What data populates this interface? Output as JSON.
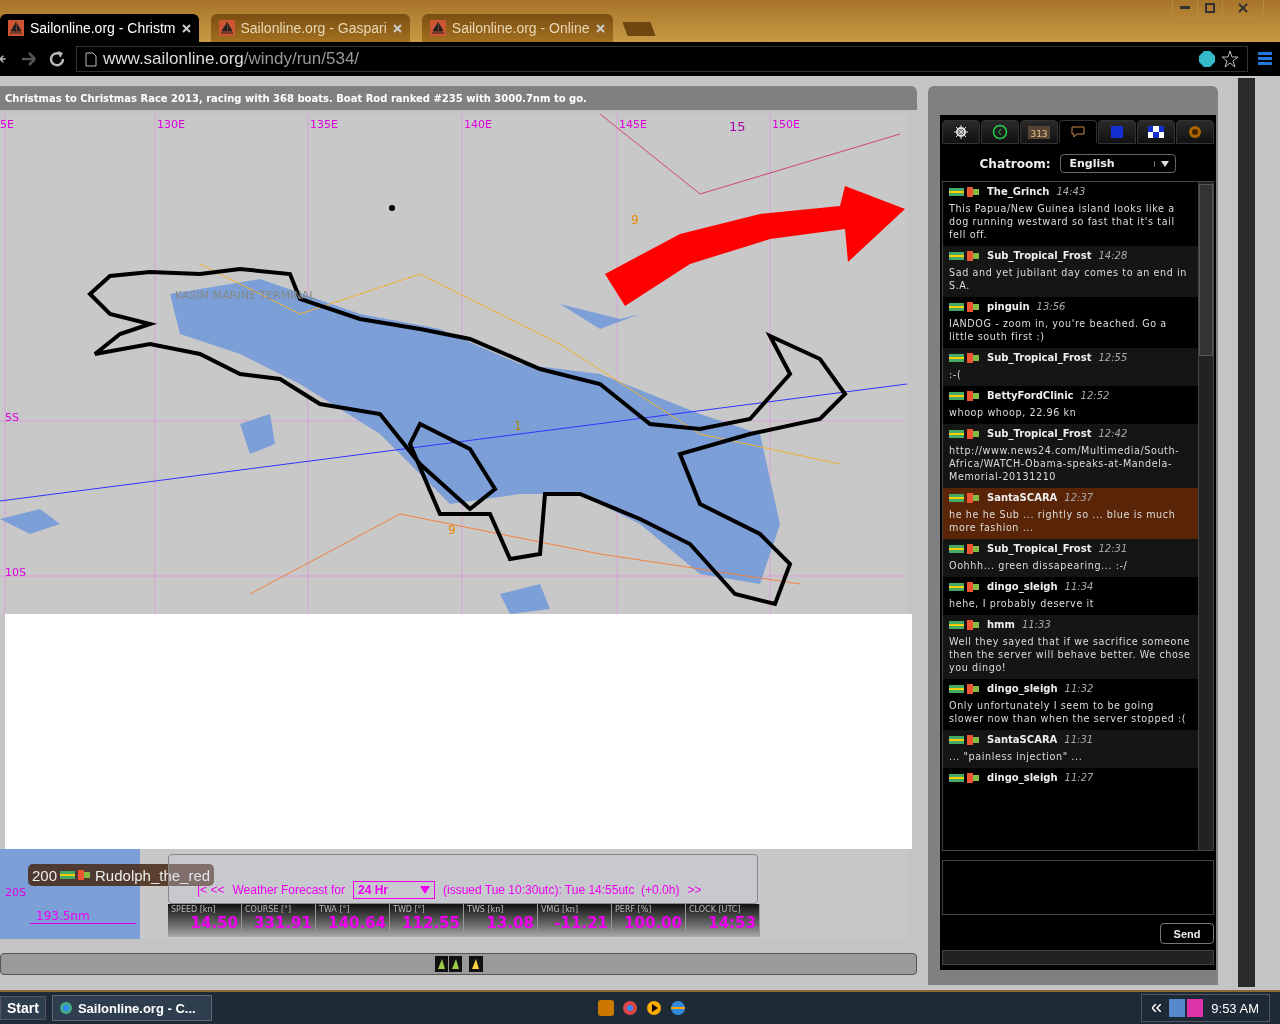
{
  "browser": {
    "tabs": [
      {
        "title": "Sailonline.org - Christm",
        "selected": true
      },
      {
        "title": "Sailonline.org - Gaspari",
        "selected": false
      },
      {
        "title": "Sailonline.org - Online",
        "selected": false
      }
    ],
    "url_host": "www.sailonline.org",
    "url_path": "/windy/run/534/"
  },
  "race_header": "Christmas to Christmas Race 2013, racing with 368 boats. Boat Rod ranked #235 with 3000.7nm to go.",
  "map": {
    "lon_labels": [
      "5E",
      "130E",
      "135E",
      "140E",
      "145E",
      "150E"
    ],
    "lat_labels": [
      "5S",
      "10S"
    ],
    "bottom_lat_label": "20S",
    "marks": [
      "15",
      "9",
      "9",
      "1"
    ],
    "place_label": "KASIM MARINE TERMINAL"
  },
  "boat_label": {
    "rank": "200",
    "name": "Rudolph_the_red"
  },
  "scale": "193.5nm",
  "forecast": {
    "prev": "|< <<",
    "label": "Weather Forecast for",
    "period": "24 Hr",
    "issued": "(issued Tue 10:30utc): Tue 14:55utc  (+0.0h)",
    "next": ">>"
  },
  "instruments": [
    {
      "label": "SPEED [kn]",
      "value": "14.50"
    },
    {
      "label": "COURSE [°]",
      "value": "331.91"
    },
    {
      "label": "TWA [°]",
      "value": "140.64"
    },
    {
      "label": "TWD [°]",
      "value": "112.55"
    },
    {
      "label": "TWS [kn]",
      "value": "13.08"
    },
    {
      "label": "VMG [kn]",
      "value": "-11.21"
    },
    {
      "label": "PERF [%]",
      "value": "100.00"
    },
    {
      "label": "CLOCK [UTC]",
      "value": "14:53"
    }
  ],
  "chat": {
    "tabs": [
      {
        "kind": "helm",
        "selected": false
      },
      {
        "kind": "clock",
        "selected": false
      },
      {
        "kind": "ranking",
        "badge": "313",
        "selected": false
      },
      {
        "kind": "chat",
        "selected": true
      },
      {
        "kind": "blue",
        "selected": false
      },
      {
        "kind": "checker",
        "selected": false
      },
      {
        "kind": "help",
        "selected": false
      }
    ],
    "room_label": "Chatroom:",
    "room": "English",
    "messages": [
      {
        "user": "The_Grinch",
        "time": "14:43",
        "text": "This Papua/New Guinea island looks like a dog running westward so fast that it's tail fell off.",
        "highlighted": false
      },
      {
        "user": "Sub_Tropical_Frost",
        "time": "14:28",
        "text": "Sad and yet jubilant day comes to an end in S.A.",
        "highlighted": false
      },
      {
        "user": "pinguin",
        "time": "13:56",
        "text": "IANDOG - zoom in, you're beached. Go a little south first :)",
        "highlighted": false
      },
      {
        "user": "Sub_Tropical_Frost",
        "time": "12:55",
        "text": ":-(",
        "highlighted": false
      },
      {
        "user": "BettyFordClinic",
        "time": "12:52",
        "text": "whoop whoop, 22.96 kn",
        "highlighted": false
      },
      {
        "user": "Sub_Tropical_Frost",
        "time": "12:42",
        "text": "http://www.news24.com/Multimedia/South-Africa/WATCH-Obama-speaks-at-Mandela-Memorial-20131210",
        "highlighted": false
      },
      {
        "user": "SantaSCARA",
        "time": "12:37",
        "text": "he he he Sub ... rightly so ... blue is much more fashion ...",
        "highlighted": true
      },
      {
        "user": "Sub_Tropical_Frost",
        "time": "12:31",
        "text": "Oohhh... green dissapearing... :-/",
        "highlighted": false
      },
      {
        "user": "dingo_sleigh",
        "time": "11:34",
        "text": "hehe, I probably deserve it",
        "highlighted": false
      },
      {
        "user": "hmm",
        "time": "11:33",
        "text": "Well they sayed that if we sacrifice someone then the server will behave better. We chose you dingo!",
        "highlighted": false
      },
      {
        "user": "dingo_sleigh",
        "time": "11:32",
        "text": "Only unfortunately I seem to be going slower now than when the server stopped :(",
        "highlighted": false
      },
      {
        "user": "SantaSCARA",
        "time": "11:31",
        "text": "... \"painless injection\" ...",
        "highlighted": false
      },
      {
        "user": "dingo_sleigh",
        "time": "11:27",
        "highlighted": false
      }
    ],
    "send": "Send"
  },
  "taskbar": {
    "start": "Start",
    "task": "Sailonline.org - C...",
    "clock": "9:53 AM"
  }
}
